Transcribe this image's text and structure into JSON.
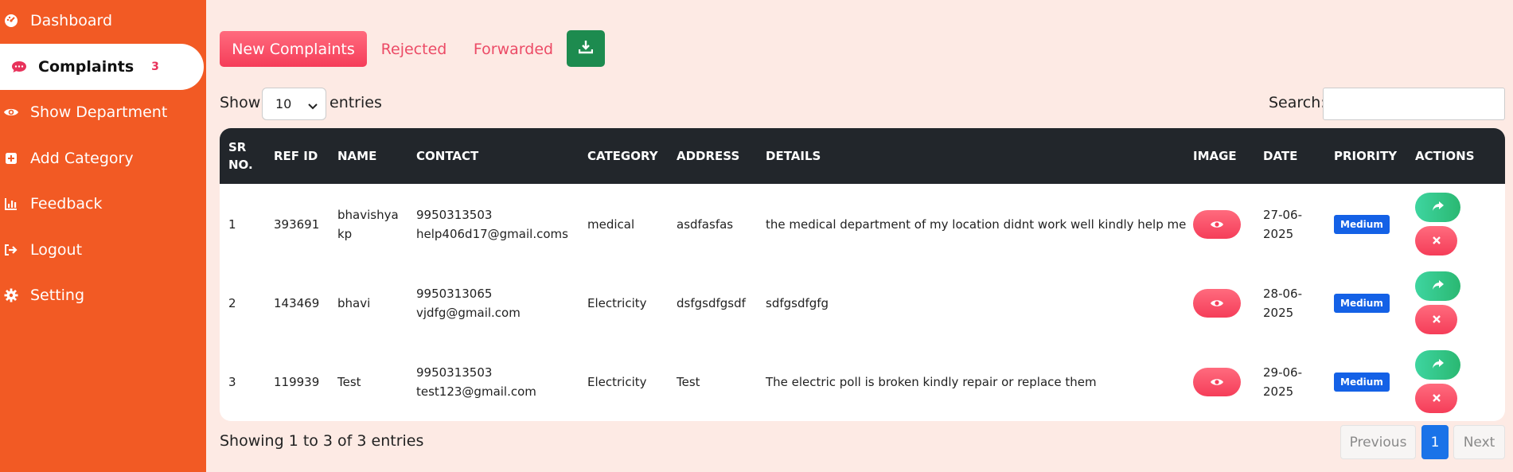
{
  "sidebar": {
    "items": [
      {
        "label": "Dashboard",
        "icon": "dashboard-gauge-icon"
      },
      {
        "label": "Complaints",
        "icon": "chat-icon",
        "badge": "3"
      },
      {
        "label": "Show Department",
        "icon": "eye-icon"
      },
      {
        "label": "Add Category",
        "icon": "plus-square-icon"
      },
      {
        "label": "Feedback",
        "icon": "chart-bar-icon"
      },
      {
        "label": "Logout",
        "icon": "logout-icon"
      },
      {
        "label": "Setting",
        "icon": "gear-icon"
      }
    ]
  },
  "tabs": {
    "new": "New Complaints",
    "rejected": "Rejected",
    "forwarded": "Forwarded",
    "download_icon": "download-icon"
  },
  "controls": {
    "show_label": "Show",
    "entries_value": "10",
    "entries_label": "entries",
    "search_label": "Search:"
  },
  "table": {
    "headers": {
      "sr1": "SR",
      "sr2": "NO.",
      "ref": "REF ID",
      "name": "NAME",
      "contact": "CONTACT",
      "category": "CATEGORY",
      "address": "ADDRESS",
      "details": "DETAILS",
      "image": "IMAGE",
      "date": "DATE",
      "priority": "PRIORITY",
      "actions": "ACTIONS"
    },
    "rows": [
      {
        "sr": "1",
        "ref": "393691",
        "name1": "bhavishya",
        "name2": "kp",
        "phone": "9950313503",
        "email": "help406d17@gmail.coms",
        "category": "medical",
        "address": "asdfasfas",
        "details": "the medical department of my location didnt work well kindly help me",
        "date1": "27-06-",
        "date2": "2025",
        "priority": "Medium"
      },
      {
        "sr": "2",
        "ref": "143469",
        "name1": "bhavi",
        "name2": "",
        "phone": "9950313065",
        "email": "vjdfg@gmail.com",
        "category": "Electricity",
        "address": "dsfgsdfgsdf",
        "details": "sdfgsdfgfg",
        "date1": "28-06-",
        "date2": "2025",
        "priority": "Medium"
      },
      {
        "sr": "3",
        "ref": "119939",
        "name1": "Test",
        "name2": "",
        "phone": "9950313503",
        "email": "test123@gmail.com",
        "category": "Electricity",
        "address": "Test",
        "details": "The electric poll is broken kindly repair or replace them",
        "date1": "29-06-",
        "date2": "2025",
        "priority": "Medium"
      }
    ]
  },
  "footer": {
    "showing": "Showing 1 to 3 of 3 entries",
    "previous": "Previous",
    "current_page": "1",
    "next": "Next"
  },
  "colors": {
    "sidebar_bg": "#f25a24",
    "page_bg": "#fdeae4",
    "accent_pink": "#f53d59",
    "header_dark": "#22262b",
    "download_green": "#1d8b4f",
    "priority_blue": "#1461e6"
  }
}
